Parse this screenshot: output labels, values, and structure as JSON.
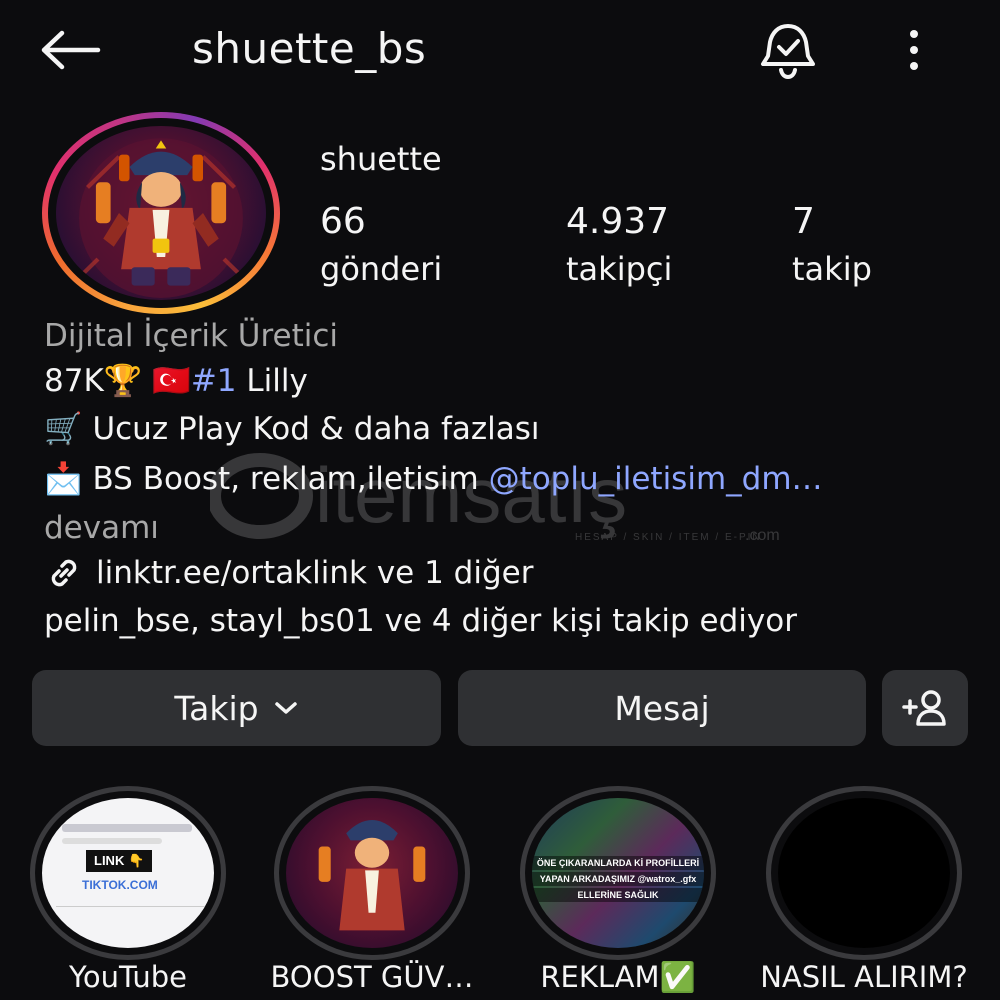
{
  "header": {
    "username": "shuette_bs",
    "back_icon": "arrow-left-icon",
    "bell_icon": "bell-check-icon",
    "more_icon": "more-vertical-icon"
  },
  "profile": {
    "display_name": "shuette",
    "stats": [
      {
        "value": "66",
        "label": "gönderi"
      },
      {
        "value": "4.937",
        "label": "takipçi"
      },
      {
        "value": "7",
        "label": "takip"
      }
    ],
    "category": "Dijital İçerik Üretici",
    "bio_line1": {
      "prefix": "87K🏆 🇹🇷",
      "hashtag": "#1",
      "suffix": " Lilly"
    },
    "bio_line2": "🛒 Ucuz Play Kod & daha fazlası",
    "bio_line3": {
      "text": "📩 BS Boost, reklam,iletisim ",
      "mention": "@toplu_iletisim_dm…"
    },
    "more_label": "devamı",
    "link_text": "linktr.ee/ortaklink ve 1 diğer",
    "followed_by": "pelin_bse, stayl_bs01 ve 4 diğer kişi takip ediyor"
  },
  "actions": {
    "follow_label": "Takip",
    "message_label": "Mesaj"
  },
  "highlights": [
    {
      "label": "YouTube",
      "img_text_1": "LINK 👇",
      "img_text_2": "TIKTOK.COM"
    },
    {
      "label": "BOOST GÜV…"
    },
    {
      "label": "REKLAM✅",
      "img_text_1": "ÖNE ÇIKARANLARDA Kİ PROFİLLERİ",
      "img_text_2": "YAPAN ARKADAŞIMIZ @watrox_.gfx",
      "img_text_3": "ELLERİNE SAĞLIK"
    },
    {
      "label": "NASIL ALIRIM?"
    }
  ],
  "watermark": {
    "brand": "itemsatış",
    "tagline": "HESAP / SKIN / ITEM / E-PIN",
    "suffix": ".com"
  }
}
